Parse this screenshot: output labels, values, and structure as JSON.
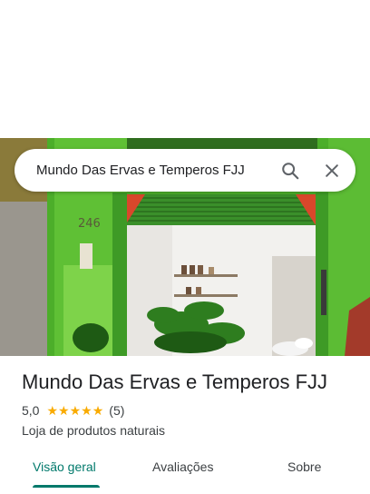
{
  "search": {
    "query": "Mundo Das Ervas e Temperos FJJ"
  },
  "photo": {
    "house_number": "246"
  },
  "place": {
    "title": "Mundo Das Ervas e Temperos FJJ",
    "rating": "5,0",
    "stars": 5,
    "review_count": "(5)",
    "category": "Loja de produtos naturais"
  },
  "tabs": [
    {
      "label": "Visão geral",
      "active": true
    },
    {
      "label": "Avaliações",
      "active": false
    },
    {
      "label": "Sobre",
      "active": false
    }
  ],
  "colors": {
    "accent": "#00796b",
    "star": "#f9ab00",
    "storefront_green": "#4cae2a"
  },
  "icons": {
    "search": "search-icon",
    "close": "close-icon",
    "star": "star-icon"
  }
}
